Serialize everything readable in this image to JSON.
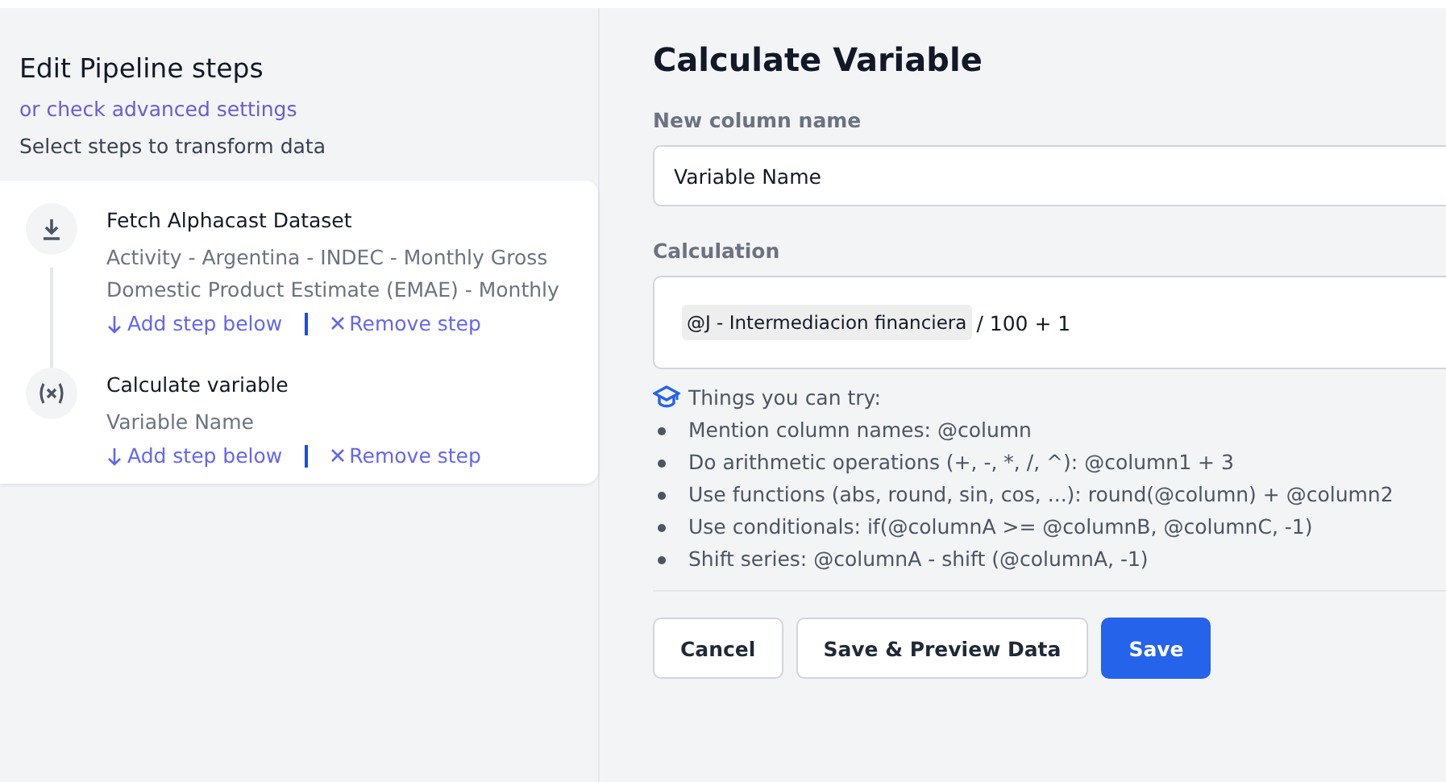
{
  "sidebar": {
    "title": "Edit Pipeline steps",
    "advanced_link": "or check advanced settings",
    "subtitle": "Select steps to transform data",
    "steps": [
      {
        "kind": "fetch",
        "title": "Fetch Alphacast Dataset",
        "description": "Activity - Argentina - INDEC - Monthly Gross Domestic Product Estimate (EMAE) - Monthly",
        "add_link": "Add step below",
        "remove_link": "Remove step"
      },
      {
        "kind": "calculate",
        "title": "Calculate variable",
        "description": "Variable Name",
        "add_link": "Add step below",
        "remove_link": "Remove step"
      }
    ]
  },
  "form": {
    "title": "Calculate Variable",
    "name_label": "New column name",
    "name_value": "Variable Name",
    "calc_label": "Calculation",
    "calc_mention": "@J - Intermediacion financiera",
    "calc_rest": "/ 100 + 1",
    "tips_title": "Things you can try:",
    "tips": [
      "Mention column names: @column",
      "Do arithmetic operations (+, -, *, /, ^): @column1 + 3",
      "Use functions (abs, round, sin, cos, ...): round(@column) + @column2",
      "Use conditionals: if(@columnA >= @columnB, @columnC, -1)",
      "Shift series: @columnA - shift (@columnA, -1)"
    ],
    "buttons": [
      {
        "label": "Cancel",
        "kind": "secondary"
      },
      {
        "label": "Save & Preview Data",
        "kind": "secondary"
      },
      {
        "label": "Save",
        "kind": "primary"
      }
    ]
  }
}
